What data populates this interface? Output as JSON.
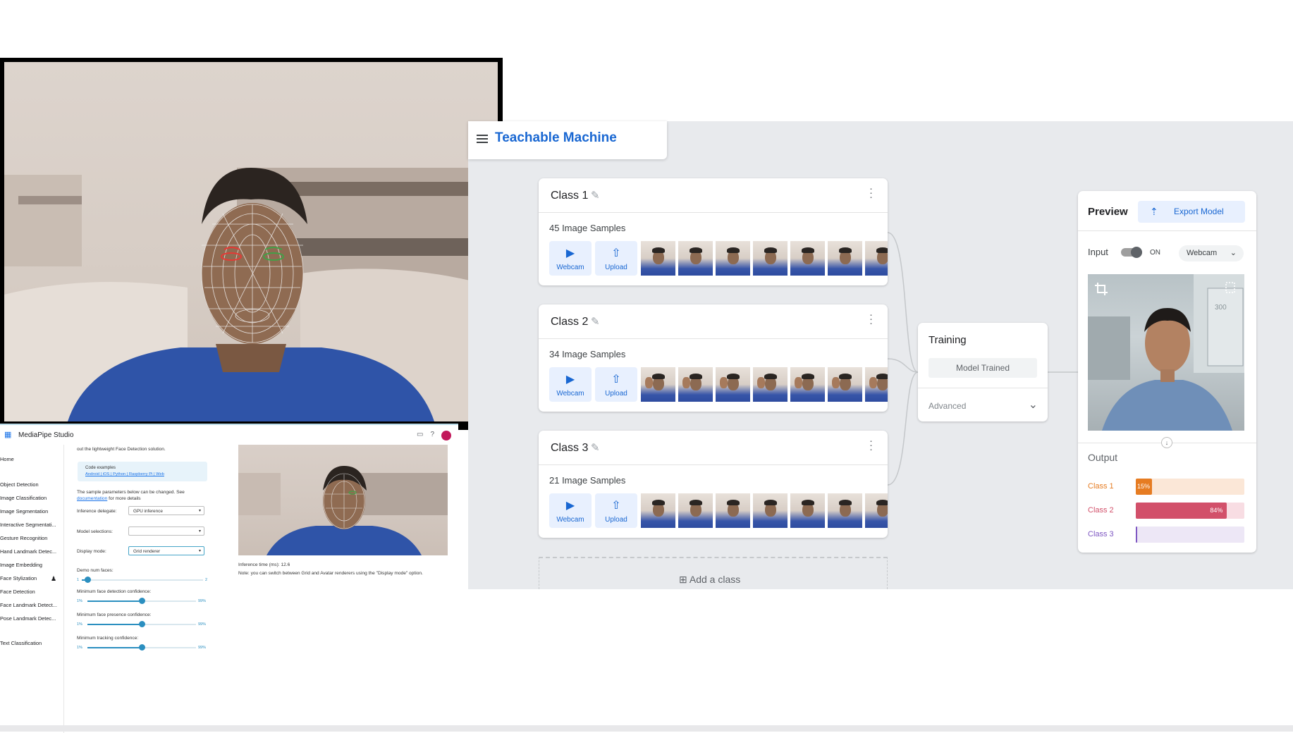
{
  "mediapipe": {
    "app_title": "MediaPipe Studio",
    "sidebar": [
      "Home",
      "Object Detection",
      "Image Classification",
      "Image Segmentation",
      "Interactive Segmentati...",
      "Gesture Recognition",
      "Hand Landmark Detec...",
      "Image Embedding",
      "Face Stylization",
      "Face Detection",
      "Face Landmark Detect...",
      "Pose Landmark Detec...",
      "Text Classification"
    ],
    "intro_text": "out the lightweight Face Detection solution.",
    "code_examples_title": "Code examples",
    "code_examples_links": "Android | iOS | Python | Raspberry Pi | Web",
    "params_note_1": "The sample parameters below can be changed. See",
    "params_note_link": "documentation",
    "params_note_2": "for more details",
    "inference_delegate_label": "Inference delegate:",
    "inference_delegate_value": "GPU inference",
    "model_selections_label": "Model selections:",
    "model_selections_value": "",
    "display_mode_label": "Display mode:",
    "display_mode_value": "Grid renderer",
    "demo_num_faces_label": "Demo num faces:",
    "demo_num_faces_min": "1",
    "demo_num_faces_max": "2",
    "demo_num_faces_value": 0.05,
    "min_face_detection_label": "Minimum face detection confidence:",
    "min_face_presence_label": "Minimum face presence confidence:",
    "min_tracking_label": "Minimum tracking confidence:",
    "slider_min": "1%",
    "slider_max": "99%",
    "slider_values": [
      0.5,
      0.5,
      0.5
    ],
    "inference_time": "Inference time (ms): 12.6",
    "inference_note": "Note: you can switch between Grid and Avatar renderers using the \"Display mode\" option."
  },
  "teachable": {
    "app_title": "Teachable Machine",
    "classes": [
      {
        "name": "Class 1",
        "samples": "45 Image Samples"
      },
      {
        "name": "Class 2",
        "samples": "34 Image Samples"
      },
      {
        "name": "Class 3",
        "samples": "21 Image Samples"
      }
    ],
    "webcam_label": "Webcam",
    "upload_label": "Upload",
    "add_class_label": "Add a class",
    "training": {
      "title": "Training",
      "button": "Model Trained",
      "advanced": "Advanced"
    },
    "preview": {
      "title": "Preview",
      "export_label": "Export Model",
      "input_label": "Input",
      "toggle_state": "ON",
      "source": "Webcam",
      "output_label": "Output",
      "outputs": [
        {
          "label": "Class 1",
          "value": 0.15,
          "text": "15%",
          "color": "#e67c22",
          "track": "#fbe7d7"
        },
        {
          "label": "Class 2",
          "value": 0.84,
          "text": "84%",
          "color": "#d2506a",
          "track": "#f8dde3"
        },
        {
          "label": "Class 3",
          "value": 0.01,
          "text": "",
          "color": "#7e57c2",
          "track": "#ede7f6"
        }
      ]
    }
  }
}
